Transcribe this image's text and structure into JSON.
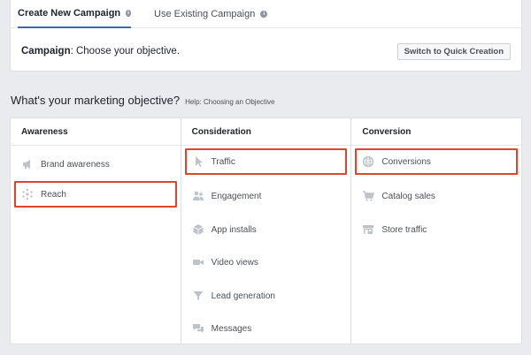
{
  "tabs": {
    "create_new": "Create New Campaign",
    "use_existing": "Use Existing Campaign"
  },
  "campaign": {
    "label": "Campaign",
    "text": ": Choose your objective.",
    "quick_creation_button": "Switch to Quick Creation"
  },
  "objective": {
    "heading": "What's your marketing objective?",
    "help_link": "Help: Choosing an Objective"
  },
  "columns": {
    "awareness": {
      "header": "Awareness",
      "items": [
        "Brand awareness",
        "Reach"
      ]
    },
    "consideration": {
      "header": "Consideration",
      "items": [
        "Traffic",
        "Engagement",
        "App installs",
        "Video views",
        "Lead generation",
        "Messages"
      ]
    },
    "conversion": {
      "header": "Conversion",
      "items": [
        "Conversions",
        "Catalog sales",
        "Store traffic"
      ]
    }
  },
  "highlighted_items": [
    "Reach",
    "Traffic",
    "Conversions"
  ],
  "colors": {
    "highlight": "#e0452b",
    "tab_underline": "#4267b2",
    "icon": "#bec3c9",
    "background": "#e9ebee"
  }
}
